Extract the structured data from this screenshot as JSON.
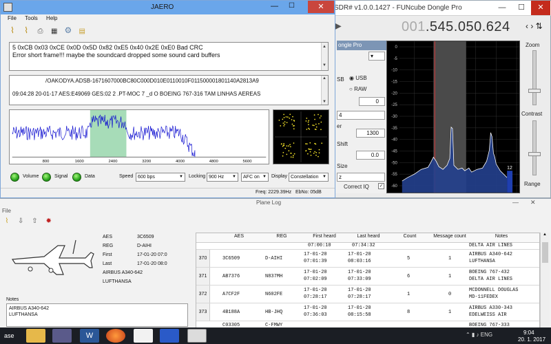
{
  "sdr": {
    "title": "SDR# v1.0.0.1427 - FUNcube Dongle Pro",
    "frequency_prefix": "001",
    "frequency_main": ".545.050.624",
    "freq_arrows": "‹ › ⇅",
    "close": "✕",
    "minimize": "—",
    "maximize": "☐",
    "zoom_label": "Zoom",
    "contrast_label": "Contrast",
    "range_label": "Range",
    "device_label": "ongle Pro",
    "mode_usb1": "SB",
    "mode_usb2": "USB",
    "mode_raw": "RAW",
    "spin_value": "0",
    "combo_value": "4",
    "field_er": "er",
    "field_1300": "1300",
    "label_shift": "Shift",
    "field_0": "0.0",
    "label_size": "Size",
    "combo_z": "z",
    "correct_iq": "Correct IQ",
    "spectrum_y_labels": [
      "0",
      "-5",
      "-10",
      "-15",
      "-20",
      "-25",
      "-30",
      "-35",
      "-40",
      "-45",
      "-50",
      "-55",
      "-60"
    ],
    "spectrum_right_label": "12",
    "colors": {
      "spectrum_bg": "#000000",
      "trace": "#ffffff",
      "fill": "#2a4aa0",
      "marker": "#d03030",
      "band": "#555555"
    }
  },
  "jaero": {
    "title": "JAERO",
    "menu": [
      "File",
      "Tools",
      "Help"
    ],
    "toolbar_icons": [
      "broom-icon",
      "broom-icon",
      "printer-icon",
      "grid-icon",
      "gear-icon",
      "document-icon"
    ],
    "log1": [
      "5 0xCB 0x03 0xCE 0x0D 0x5D 0x82 0xE5 0x40 0x2E 0xE0 Bad CRC",
      "Error short frame!!! maybe the soundcard dropped some sound card buffers"
    ],
    "log2_line1": "/OAKODYA.ADSB-1671607000BC80C000D010E0110010F011500001801140A2813A9",
    "log2_line2": "09:04:28 20-01-17 AES:E49069 GES:02 2 .PT-MOC 7 _d O BOEING 767-316 TAM LINHAS AEREAS",
    "waterfall_x_labels": [
      "800",
      "1600",
      "2400",
      "3200",
      "4000",
      "4800",
      "5600"
    ],
    "led_labels": [
      "Volume",
      "Signal",
      "Data"
    ],
    "speed_label": "Speed",
    "speed_value": "600 bps",
    "locking_label": "Locking",
    "locking_value": "900 Hz",
    "afc_value": "AFC on",
    "display_label": "Display",
    "display_value": "Constellation",
    "status_freq": "Freq: 2229.39Hz",
    "status_ebno": "EbNo: 05dB",
    "colors": {
      "trace": "#1010d0",
      "band": "#a7dcb8",
      "titlebar": "#6aa6ea"
    }
  },
  "planelog": {
    "title": "Plane Log",
    "file_menu": "File",
    "toolbar_icons": [
      "broom-icon",
      "import-icon",
      "export-icon",
      "stop-icon"
    ],
    "info": [
      {
        "key": "AES",
        "value": "3C6509"
      },
      {
        "key": "REG",
        "value": "D-AIHI"
      },
      {
        "key": "First",
        "value": "17-01-20 07:0"
      },
      {
        "key": "Last",
        "value": "17-01-20 08:0"
      },
      {
        "key": "",
        "value": "AIRBUS A340-642"
      },
      {
        "key": "",
        "value": "LUFTHANSA"
      }
    ],
    "notes_label": "Notes",
    "notes_lines": [
      "AIRBUS A340-642",
      "LUFTHANSA"
    ],
    "columns": [
      "AES",
      "REG",
      "First heard",
      "Last heard",
      "Count",
      "Message count",
      "Notes"
    ],
    "top_partial": {
      "first": "07:00:10",
      "last": "07:34:32",
      "notes": "DELTA AIR LINES"
    },
    "rows": [
      {
        "num": "370",
        "aes": "3C6509",
        "reg": "D-AIHI",
        "first_d": "17-01-20",
        "first_t": "07:01:39",
        "last_d": "17-01-20",
        "last_t": "08:03:16",
        "count": "5",
        "msgs": "1",
        "notes1": "AIRBUS A340-642",
        "notes2": "LUFTHANSA"
      },
      {
        "num": "371",
        "aes": "AB7376",
        "reg": "N837MH",
        "first_d": "17-01-20",
        "first_t": "07:02:09",
        "last_d": "17-01-20",
        "last_t": "07:33:09",
        "count": "6",
        "msgs": "1",
        "notes1": "BOEING 767-432",
        "notes2": "DELTA AIR LINES"
      },
      {
        "num": "372",
        "aes": "A7CF2F",
        "reg": "N602FE",
        "first_d": "17-01-20",
        "first_t": "07:28:17",
        "last_d": "17-01-20",
        "last_t": "07:28:17",
        "count": "1",
        "msgs": "0",
        "notes1": "MCDONNELL DOUGLAS",
        "notes2": "MD-11FEDEX"
      },
      {
        "num": "373",
        "aes": "4B188A",
        "reg": "HB-JHQ",
        "first_d": "17-01-20",
        "first_t": "07:36:03",
        "last_d": "17-01-20",
        "last_t": "08:15:58",
        "count": "8",
        "msgs": "1",
        "notes1": "AIRBUS A330-343",
        "notes2": "EDELWEISS AIR"
      }
    ],
    "bottom_partial": {
      "aes": "C03305",
      "reg": "C-FMWY",
      "notes": "BOEING 767-333"
    }
  },
  "taskbar": {
    "time": "9:04",
    "date": "20. 1. 2017",
    "tray": "⌃ ▮ ♪ ENG",
    "apps": [
      "start-icon",
      "file-explorer-icon",
      "app-icon",
      "word-icon",
      "firefox-icon",
      "sdr-icon",
      "wave-icon",
      "jaero-icon"
    ]
  }
}
